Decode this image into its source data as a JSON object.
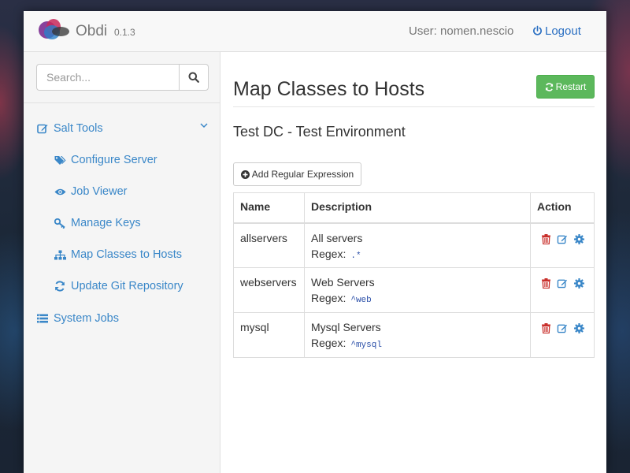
{
  "header": {
    "brand": "Obdi",
    "version": "0.1.3",
    "user": "User: nomen.nescio",
    "logout": "Logout"
  },
  "sidebar": {
    "search_placeholder": "Search...",
    "group": {
      "label": "Salt Tools",
      "icon": "edit-icon",
      "expanded": true
    },
    "items": [
      {
        "label": "Configure Server",
        "icon": "tags-icon"
      },
      {
        "label": "Job Viewer",
        "icon": "eye-icon"
      },
      {
        "label": "Manage Keys",
        "icon": "key-icon"
      },
      {
        "label": "Map Classes to Hosts",
        "icon": "sitemap-icon"
      },
      {
        "label": "Update Git Repository",
        "icon": "refresh-icon"
      }
    ],
    "system_jobs": {
      "label": "System Jobs",
      "icon": "list-icon"
    }
  },
  "main": {
    "title": "Map Classes to Hosts",
    "restart_label": "Restart",
    "subtitle": "Test DC - Test Environment",
    "add_label": "Add Regular Expression",
    "table": {
      "headers": [
        "Name",
        "Description",
        "Action"
      ],
      "regex_label": "Regex:",
      "rows": [
        {
          "name": "allservers",
          "description": "All servers",
          "regex": ".*"
        },
        {
          "name": "webservers",
          "description": "Web Servers",
          "regex": "^web"
        },
        {
          "name": "mysql",
          "description": "Mysql Servers",
          "regex": "^mysql"
        }
      ]
    }
  },
  "colors": {
    "link": "#3a87c8",
    "success": "#5cb85c",
    "danger": "#c9302c",
    "regex": "#2b4fa8"
  }
}
